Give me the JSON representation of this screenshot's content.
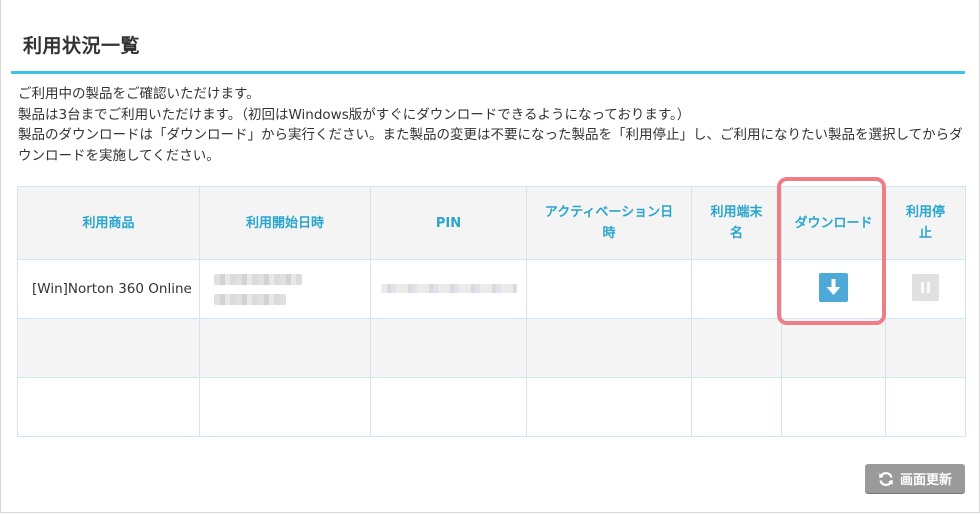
{
  "page": {
    "title": "利用状況一覧"
  },
  "intro": {
    "lines": [
      "ご利用中の製品をご確認いただけます。",
      "製品は3台までご利用いただけます。（初回はWindows版がすぐにダウンロードできるようになっております。）",
      "製品のダウンロードは「ダウンロード」から実行ください。また製品の変更は不要になった製品を「利用停止」し、ご利用になりたい製品を選択してからダウンロードを実施してください。"
    ]
  },
  "table": {
    "headers": {
      "product": "利用商品",
      "start_date": "利用開始日時",
      "pin": "PIN",
      "activation_date": "アクティベーション日時",
      "device_name": "利用端末名",
      "download": "ダウンロード",
      "stop": "利用停止"
    },
    "rows": [
      {
        "product": "[Win]Norton 360 Online",
        "start_date": "",
        "pin": "",
        "activation_date": "",
        "device_name": "",
        "has_download": true,
        "has_stop": true
      },
      {
        "product": "",
        "start_date": "",
        "pin": "",
        "activation_date": "",
        "device_name": ""
      },
      {
        "product": "",
        "start_date": "",
        "pin": "",
        "activation_date": "",
        "device_name": ""
      }
    ]
  },
  "icons": {
    "download": "download-arrow-icon",
    "stop": "pause-icon",
    "refresh": "refresh-icon"
  },
  "colors": {
    "accent": "#3cc3e6",
    "header_text": "#2aa6cc",
    "download_button": "#4ea8d8",
    "highlight": "#f07c86",
    "refresh_button": "#9a9a9a"
  },
  "refresh_button": {
    "label": "画面更新"
  }
}
